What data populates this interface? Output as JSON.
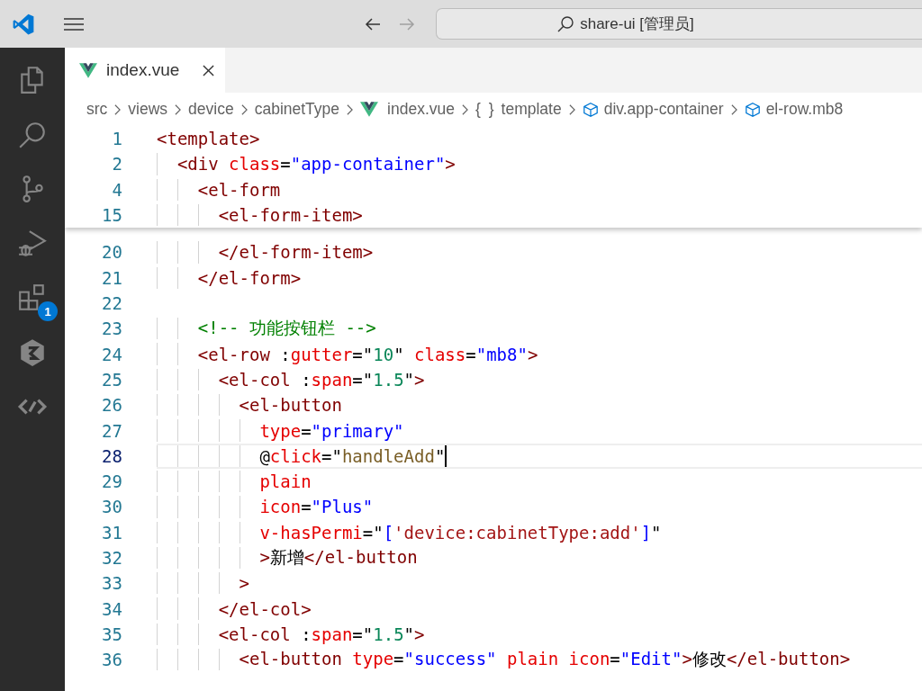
{
  "title_bar": {
    "back": {
      "disabled": false
    },
    "forward": {
      "disabled": true
    },
    "command_center": "share-ui [管理员]"
  },
  "activity_bar": [
    {
      "kind": "files"
    },
    {
      "kind": "search"
    },
    {
      "kind": "source_control"
    },
    {
      "kind": "debug"
    },
    {
      "kind": "extensions",
      "badge": "1"
    },
    {
      "kind": "hexagon"
    },
    {
      "kind": "remote"
    }
  ],
  "tabs": [
    {
      "label": "index.vue",
      "selected": true
    }
  ],
  "breadcrumbs": [
    {
      "label": "src"
    },
    {
      "label": "views"
    },
    {
      "label": "device"
    },
    {
      "label": "cabinetType"
    },
    {
      "label": "index.vue",
      "kind": "vue"
    },
    {
      "label": "template",
      "symbol": "{ }"
    },
    {
      "label": "div.app-container",
      "kind": "cube"
    },
    {
      "label": "el-row.mb8",
      "kind": "cube"
    }
  ],
  "sticky_lines": [
    {
      "number": "1",
      "tokens": [
        {
          "kind": "tag",
          "text": "<template>"
        }
      ]
    },
    {
      "number": "2",
      "tokens": [
        {
          "kind": "tag",
          "text": "  <div "
        },
        {
          "kind": "attr",
          "text": "class"
        },
        {
          "kind": "op",
          "text": "="
        },
        {
          "kind": "str",
          "text": "\"app-container\""
        },
        {
          "kind": "tag",
          "text": ">"
        }
      ]
    },
    {
      "number": "4",
      "tokens": [
        {
          "kind": "tag",
          "text": "    <el-form"
        }
      ]
    },
    {
      "number": "15",
      "tokens": [
        {
          "kind": "tag",
          "text": "      <el-form-item>"
        }
      ]
    }
  ],
  "lines": [
    {
      "number": "20",
      "current": false,
      "tokens": [
        {
          "kind": "tag",
          "text": "      </el-form-item>"
        }
      ]
    },
    {
      "number": "21",
      "current": false,
      "tokens": [
        {
          "kind": "tag",
          "text": "    </el-form>"
        }
      ]
    },
    {
      "number": "22",
      "current": false
    },
    {
      "number": "23",
      "current": false,
      "tokens": [
        {
          "kind": "comment",
          "text": "    <!-- 功能按钮栏 -->"
        }
      ]
    },
    {
      "number": "24",
      "current": false,
      "tokens": [
        {
          "kind": "tag",
          "text": "    <el-row "
        },
        {
          "kind": "op",
          "text": ":"
        },
        {
          "kind": "attr",
          "text": "gutter"
        },
        {
          "kind": "op",
          "text": "=\""
        },
        {
          "kind": "num",
          "text": "10"
        },
        {
          "kind": "op",
          "text": "\" "
        },
        {
          "kind": "attr",
          "text": "class"
        },
        {
          "kind": "op",
          "text": "="
        },
        {
          "kind": "str",
          "text": "\"mb8\""
        },
        {
          "kind": "tag",
          "text": ">"
        }
      ]
    },
    {
      "number": "25",
      "current": false,
      "tokens": [
        {
          "kind": "tag",
          "text": "      <el-col "
        },
        {
          "kind": "op",
          "text": ":"
        },
        {
          "kind": "attr",
          "text": "span"
        },
        {
          "kind": "op",
          "text": "=\""
        },
        {
          "kind": "num",
          "text": "1.5"
        },
        {
          "kind": "op",
          "text": "\""
        },
        {
          "kind": "tag",
          "text": ">"
        }
      ]
    },
    {
      "number": "26",
      "current": false,
      "tokens": [
        {
          "kind": "tag",
          "text": "        <el-button"
        }
      ]
    },
    {
      "number": "27",
      "current": false,
      "tokens": [
        {
          "kind": "attr",
          "text": "          type"
        },
        {
          "kind": "op",
          "text": "="
        },
        {
          "kind": "str",
          "text": "\"primary\""
        }
      ]
    },
    {
      "number": "28",
      "current": true,
      "tokens": [
        {
          "kind": "op",
          "text": "          @"
        },
        {
          "kind": "attr",
          "text": "click"
        },
        {
          "kind": "op",
          "text": "=\""
        },
        {
          "kind": "expr",
          "text": "handleAdd"
        },
        {
          "kind": "op",
          "text": "\""
        }
      ]
    },
    {
      "number": "29",
      "current": false,
      "tokens": [
        {
          "kind": "attr",
          "text": "          plain"
        }
      ]
    },
    {
      "number": "30",
      "current": false,
      "tokens": [
        {
          "kind": "attr",
          "text": "          icon"
        },
        {
          "kind": "op",
          "text": "="
        },
        {
          "kind": "str",
          "text": "\"Plus\""
        }
      ]
    },
    {
      "number": "31",
      "current": false,
      "tokens": [
        {
          "kind": "attr",
          "text": "          v-hasPermi"
        },
        {
          "kind": "op",
          "text": "=\""
        },
        {
          "kind": "str",
          "text": "["
        },
        {
          "kind": "strlit",
          "text": "'device:cabinetType:add'"
        },
        {
          "kind": "str",
          "text": "]"
        },
        {
          "kind": "op",
          "text": "\""
        }
      ]
    },
    {
      "number": "32",
      "current": false,
      "tokens": [
        {
          "kind": "tag",
          "text": "          >"
        },
        {
          "kind": "text",
          "text": "新增"
        },
        {
          "kind": "tag",
          "text": "</el-button"
        }
      ]
    },
    {
      "number": "33",
      "current": false,
      "tokens": [
        {
          "kind": "tag",
          "text": "        >"
        }
      ]
    },
    {
      "number": "34",
      "current": false,
      "tokens": [
        {
          "kind": "tag",
          "text": "      </el-col>"
        }
      ]
    },
    {
      "number": "35",
      "current": false,
      "tokens": [
        {
          "kind": "tag",
          "text": "      <el-col "
        },
        {
          "kind": "op",
          "text": ":"
        },
        {
          "kind": "attr",
          "text": "span"
        },
        {
          "kind": "op",
          "text": "=\""
        },
        {
          "kind": "num",
          "text": "1.5"
        },
        {
          "kind": "op",
          "text": "\""
        },
        {
          "kind": "tag",
          "text": ">"
        }
      ]
    },
    {
      "number": "36",
      "current": false,
      "tokens": [
        {
          "kind": "tag",
          "text": "        <el-button "
        },
        {
          "kind": "attr",
          "text": "type"
        },
        {
          "kind": "op",
          "text": "="
        },
        {
          "kind": "str",
          "text": "\"success\" "
        },
        {
          "kind": "attr",
          "text": "plain icon"
        },
        {
          "kind": "op",
          "text": "="
        },
        {
          "kind": "str",
          "text": "\"Edit\""
        },
        {
          "kind": "tag",
          "text": ">"
        },
        {
          "kind": "text",
          "text": "修改"
        },
        {
          "kind": "tag",
          "text": "</el-button>"
        }
      ]
    }
  ]
}
